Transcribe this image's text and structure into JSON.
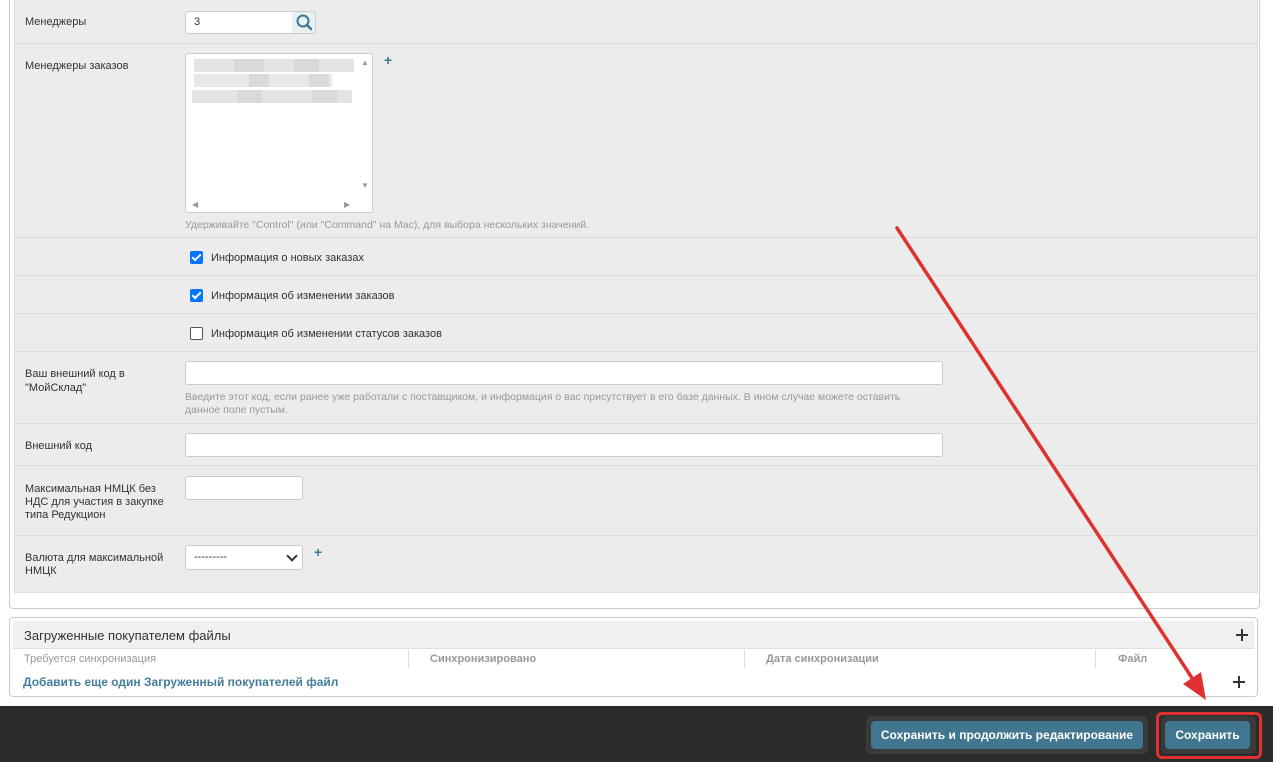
{
  "form": {
    "managers": {
      "label": "Менеджеры",
      "value": "3"
    },
    "order_managers": {
      "label": "Менеджеры заказов",
      "help": "Удерживайте \"Control\" (или \"Command\" на Mac), для выбора нескольких значений."
    },
    "checkboxes": [
      {
        "label": "Информация о новых заказах",
        "checked": true
      },
      {
        "label": "Информация об изменении заказов",
        "checked": true
      },
      {
        "label": "Информация об изменении статусов заказов",
        "checked": false
      }
    ],
    "external_code_moysklad": {
      "label_line1": "Ваш внешний код в",
      "label_line2": "\"МойСклад\"",
      "value": "",
      "help_line1": "Введите этот код, если ранее уже работали с поставщиком, и информация о вас присутствует в его базе данных. В ином случае можете оставить",
      "help_line2": "данное поле пустым."
    },
    "external_code": {
      "label": "Внешний код",
      "value": ""
    },
    "max_nmck": {
      "label_line1": "Максимальная НМЦК без",
      "label_line2": "НДС для участия в закупке",
      "label_line3": "типа Редукцион",
      "value": ""
    },
    "currency": {
      "label_line1": "Валюта для максимальной",
      "label_line2": "НМЦК",
      "selected": "---------"
    }
  },
  "inline": {
    "title": "Загруженные покупателем файлы",
    "columns": [
      "Требуется синхронизация",
      "Синхронизировано",
      "Дата синхронизации",
      "Файл"
    ],
    "add_link": "Добавить еще один Загруженный покупателей файл"
  },
  "footer": {
    "save_continue_label": "Сохранить и продолжить редактирование",
    "save_label": "Сохранить"
  },
  "colors": {
    "accent": "#417690",
    "link": "#447e9b",
    "annotation_red": "#e03131",
    "footer_bg": "#2b2b2b"
  }
}
